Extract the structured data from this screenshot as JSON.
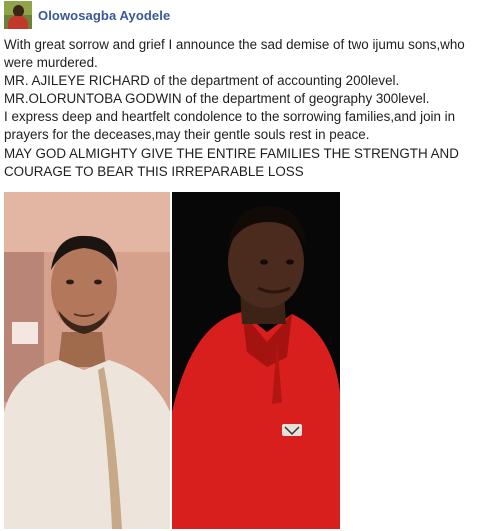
{
  "post": {
    "author": "Olowosagba Ayodele",
    "lines": [
      "With great sorrow and grief I announce the sad demise of two ijumu sons,who were murdered.",
      "MR. AJILEYE RICHARD  of the department of accounting 200level.",
      "MR.OLORUNTOBA  GODWIN of the department of geography 300level.",
      "I express deep and heartfelt condolence to the sorrowing families,and join in prayers for the deceases,may their gentle souls rest in peace.",
      "MAY GOD ALMIGHTY GIVE THE ENTIRE FAMILIES THE STRENGTH AND COURAGE TO BEAR THIS IRREPARABLE LOSS"
    ]
  },
  "colors": {
    "author_link": "#385898",
    "text": "#1c1e21",
    "left_photo_bg": "#d9a792",
    "right_photo_bg": "#0a0a0a",
    "red_shirt": "#d9201c"
  },
  "icons": {
    "avatar": "profile-avatar"
  }
}
